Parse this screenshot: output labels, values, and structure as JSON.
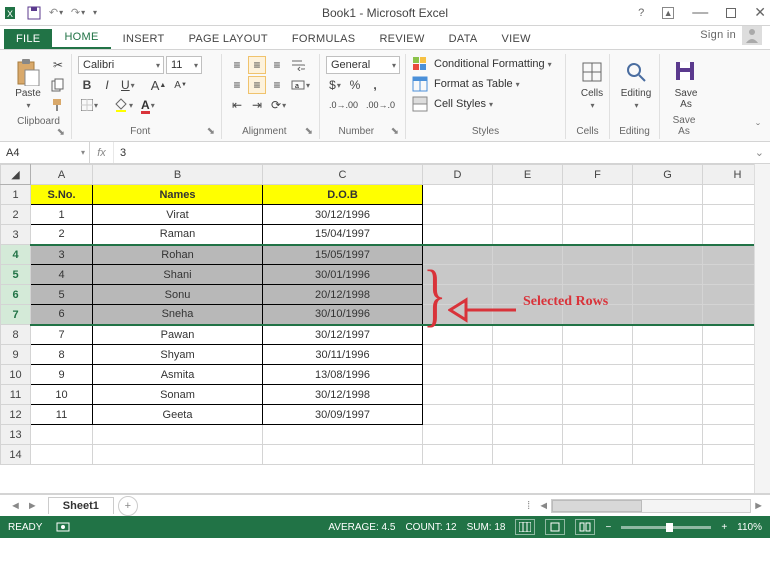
{
  "title": "Book1 - Microsoft Excel",
  "signin": "Sign in",
  "tabs": {
    "file": "FILE",
    "home": "HOME",
    "insert": "INSERT",
    "pagelayout": "PAGE LAYOUT",
    "formulas": "FORMULAS",
    "review": "REVIEW",
    "data": "DATA",
    "view": "VIEW"
  },
  "ribbon": {
    "clipboard": {
      "label": "Clipboard",
      "paste": "Paste"
    },
    "font": {
      "label": "Font",
      "name": "Calibri",
      "size": "11"
    },
    "alignment": {
      "label": "Alignment"
    },
    "number": {
      "label": "Number",
      "format": "General"
    },
    "styles": {
      "label": "Styles",
      "cond": "Conditional Formatting",
      "table": "Format as Table",
      "cell": "Cell Styles"
    },
    "cells": {
      "label": "Cells",
      "btn": "Cells"
    },
    "editing": {
      "label": "Editing",
      "btn": "Editing"
    },
    "saveas": {
      "label": "Save As",
      "btn": "Save\nAs"
    }
  },
  "namebox": "A4",
  "formula": "3",
  "columns": [
    "A",
    "B",
    "C",
    "D",
    "E",
    "F",
    "G",
    "H"
  ],
  "headers": {
    "sno": "S.No.",
    "names": "Names",
    "dob": "D.O.B"
  },
  "rows": [
    {
      "n": "1",
      "sno": "1",
      "name": "Virat",
      "dob": "30/12/1996"
    },
    {
      "n": "2",
      "sno": "2",
      "name": "Raman",
      "dob": "15/04/1997"
    },
    {
      "n": "3",
      "sno": "3",
      "name": "Rohan",
      "dob": "15/05/1997"
    },
    {
      "n": "4",
      "sno": "4",
      "name": "Shani",
      "dob": "30/01/1996"
    },
    {
      "n": "5",
      "sno": "5",
      "name": "Sonu",
      "dob": "20/12/1998"
    },
    {
      "n": "6",
      "sno": "6",
      "name": "Sneha",
      "dob": "30/10/1996"
    },
    {
      "n": "7",
      "sno": "7",
      "name": "Pawan",
      "dob": "30/12/1997"
    },
    {
      "n": "8",
      "sno": "8",
      "name": "Shyam",
      "dob": "30/11/1996"
    },
    {
      "n": "9",
      "sno": "9",
      "name": "Asmita",
      "dob": "13/08/1996"
    },
    {
      "n": "10",
      "sno": "10",
      "name": "Sonam",
      "dob": "30/12/1998"
    },
    {
      "n": "11",
      "sno": "11",
      "name": "Geeta",
      "dob": "30/09/1997"
    }
  ],
  "emptyrows": [
    "13",
    "14"
  ],
  "annotation": "Selected Rows",
  "sheet": "Sheet1",
  "status": {
    "ready": "READY",
    "avg": "AVERAGE: 4.5",
    "count": "COUNT: 12",
    "sum": "SUM: 18",
    "zoom": "110%"
  }
}
